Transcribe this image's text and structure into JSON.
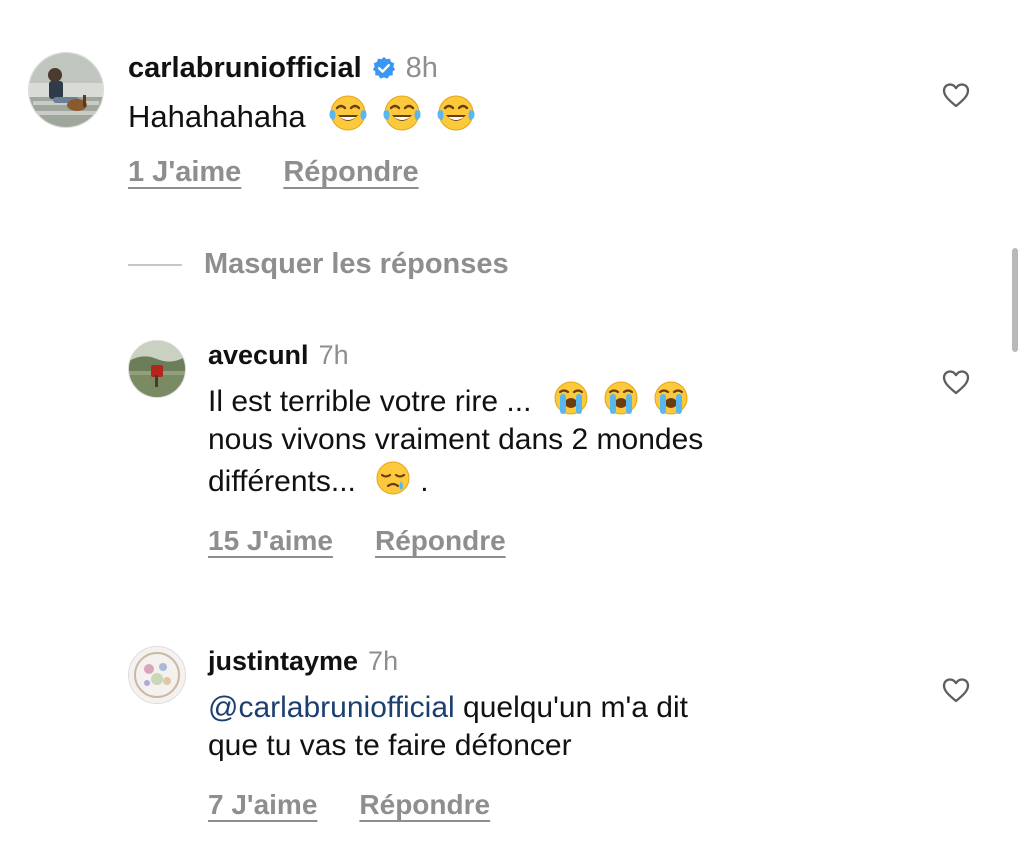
{
  "comments": [
    {
      "username": "carlabruniofficial",
      "verified": true,
      "time": "8h",
      "text": "Hahahahaha",
      "emojis": [
        "face-with-tears-of-joy",
        "face-with-tears-of-joy",
        "face-with-tears-of-joy"
      ],
      "likes_label": "1 J'aime",
      "reply_label": "Répondre"
    },
    {
      "username": "avecunl",
      "verified": false,
      "time": "7h",
      "text_line1": "Il est terrible votre rire ...",
      "line1_emojis": [
        "loudly-crying-face",
        "loudly-crying-face",
        "loudly-crying-face"
      ],
      "text_line2": "nous vivons vraiment dans 2 mondes",
      "text_line3": "différents...",
      "line3_emoji": "sleepy-face",
      "text_line3_end": ".",
      "likes_label": "15 J'aime",
      "reply_label": "Répondre"
    },
    {
      "username": "justintayme",
      "verified": false,
      "time": "7h",
      "mention": "@carlabruniofficial",
      "text_line1": " quelqu'un m'a dit",
      "text_line2": "que tu vas te faire défoncer",
      "likes_label": "7 J'aime",
      "reply_label": "Répondre"
    }
  ],
  "thread": {
    "hide_replies_label": "Masquer les réponses"
  },
  "icons": {
    "verified": "verified-badge-icon",
    "like": "heart-outline-icon"
  },
  "colors": {
    "verified_blue": "#3897f0",
    "mention_blue": "#1c3f72",
    "muted_gray": "#8e8e8e"
  }
}
